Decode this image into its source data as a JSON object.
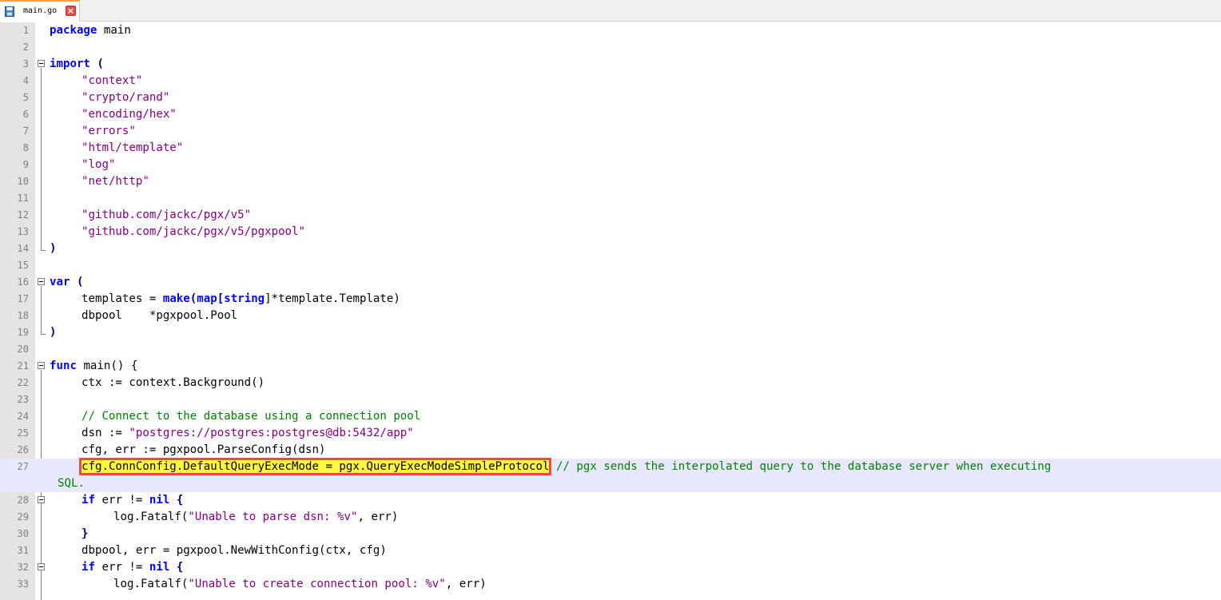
{
  "tab": {
    "filename": "main.go",
    "icon": "save-disk-icon",
    "close_icon": "close-icon"
  },
  "colors": {
    "keyword": "#0000ff",
    "string": "#800080",
    "comment": "#008000",
    "highlight": "#fffb3d",
    "highlight_border": "#ea4a4a",
    "current_line": "#e8e8ff"
  },
  "lines": {
    "n1": "1",
    "n2": "2",
    "n3": "3",
    "n4": "4",
    "n5": "5",
    "n6": "6",
    "n7": "7",
    "n8": "8",
    "n9": "9",
    "n10": "10",
    "n11": "11",
    "n12": "12",
    "n13": "13",
    "n14": "14",
    "n15": "15",
    "n16": "16",
    "n17": "17",
    "n18": "18",
    "n19": "19",
    "n20": "20",
    "n21": "21",
    "n22": "22",
    "n23": "23",
    "n24": "24",
    "n25": "25",
    "n26": "26",
    "n27": "27",
    "n28": "28",
    "n29": "29",
    "n30": "30",
    "n31": "31",
    "n32": "32",
    "n33": "33"
  },
  "code": {
    "l1_kw": "package",
    "l1_rest": " main",
    "l3_kw": "import",
    "l3_rest": " (",
    "l4": "\"context\"",
    "l5": "\"crypto/rand\"",
    "l6": "\"encoding/hex\"",
    "l7": "\"errors\"",
    "l8": "\"html/template\"",
    "l9": "\"log\"",
    "l10": "\"net/http\"",
    "l12": "\"github.com/jackc/pgx/v5\"",
    "l13": "\"github.com/jackc/pgx/v5/pgxpool\"",
    "l14": ")",
    "l16_kw": "var",
    "l16_rest": " (",
    "l17_a": "templates = ",
    "l17_make": "make",
    "l17_b": "(",
    "l17_map": "map",
    "l17_c": "[",
    "l17_string": "string",
    "l17_d": "]*template.Template)",
    "l18": "dbpool    *pgxpool.Pool",
    "l19": ")",
    "l21_kw": "func",
    "l21_rest": " main() {",
    "l22": "ctx := context.Background()",
    "l24": "// Connect to the database using a connection pool",
    "l25_a": "dsn := ",
    "l25_str": "\"postgres://postgres:postgres@db:5432/app\"",
    "l26": "cfg, err := pgxpool.ParseConfig(dsn)",
    "l27_hl": "cfg.ConnConfig.DefaultQueryExecMode = pgx.QueryExecModeSimpleProtocol",
    "l27_cm": " // pgx sends the interpolated query to the database server when executing",
    "l27_cont": "SQL.",
    "l28_kw": "if",
    "l28_a": " err != ",
    "l28_nil": "nil",
    "l28_b": " {",
    "l29_a": "log.Fatalf(",
    "l29_str": "\"Unable to parse dsn: %v\"",
    "l29_b": ", err)",
    "l30": "}",
    "l31": "dbpool, err = pgxpool.NewWithConfig(ctx, cfg)",
    "l32_kw": "if",
    "l32_a": " err != ",
    "l32_nil": "nil",
    "l32_b": " {",
    "l33_a": "log.Fatalf(",
    "l33_str": "\"Unable to create connection pool: %v\"",
    "l33_b": ", err)"
  }
}
